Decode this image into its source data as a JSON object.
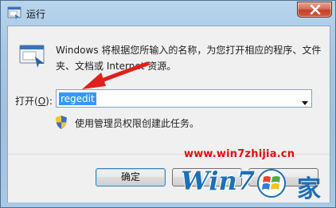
{
  "window": {
    "title": "运行",
    "icons": {
      "app": "run-icon",
      "close": "close-icon"
    }
  },
  "content": {
    "description": "Windows 将根据您所输入的名称，为您打开相应的程序、文件夹、文档或 Internet 资源。",
    "open_label": "打开(",
    "open_accel": "O",
    "open_label_end": "):",
    "command_value": "regedit",
    "admin_note": "使用管理员权限创建此任务。"
  },
  "buttons": {
    "ok": "确定",
    "cancel": "",
    "browse": ""
  },
  "watermark": {
    "url": "www.win7zhijia.cn",
    "logo_text": "Win7",
    "logo_text2": "家"
  },
  "colors": {
    "selection": "#3399ff",
    "arrow": "#e0201a",
    "close": "#c4402a",
    "watermark": "#1d6fb8"
  }
}
